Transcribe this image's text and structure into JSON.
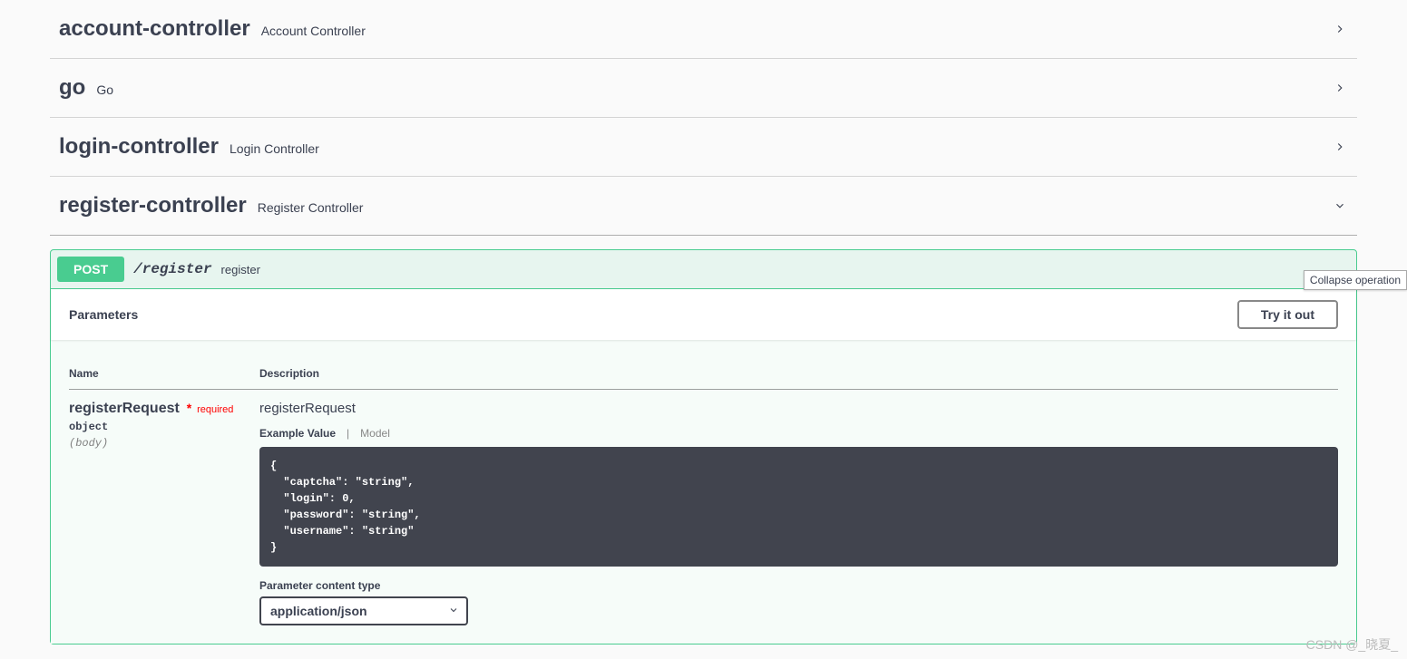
{
  "tags": [
    {
      "name": "account-controller",
      "desc": "Account Controller",
      "expanded": false
    },
    {
      "name": "go",
      "desc": "Go",
      "expanded": false
    },
    {
      "name": "login-controller",
      "desc": "Login Controller",
      "expanded": false
    },
    {
      "name": "register-controller",
      "desc": "Register Controller",
      "expanded": true
    }
  ],
  "operation": {
    "method": "POST",
    "path": "/register",
    "summary": "register",
    "parameters_header": "Parameters",
    "try_out_label": "Try it out",
    "columns": {
      "name": "Name",
      "description": "Description"
    },
    "param": {
      "name": "registerRequest",
      "required_label": "required",
      "type": "object",
      "in": "(body)",
      "desc": "registerRequest",
      "example_label": "Example Value",
      "model_label": "Model",
      "example_value": "{\n  \"captcha\": \"string\",\n  \"login\": 0,\n  \"password\": \"string\",\n  \"username\": \"string\"\n}",
      "content_type_label": "Parameter content type",
      "content_type_value": "application/json"
    }
  },
  "tooltip": "Collapse operation",
  "watermark": "CSDN @_晓夏_"
}
